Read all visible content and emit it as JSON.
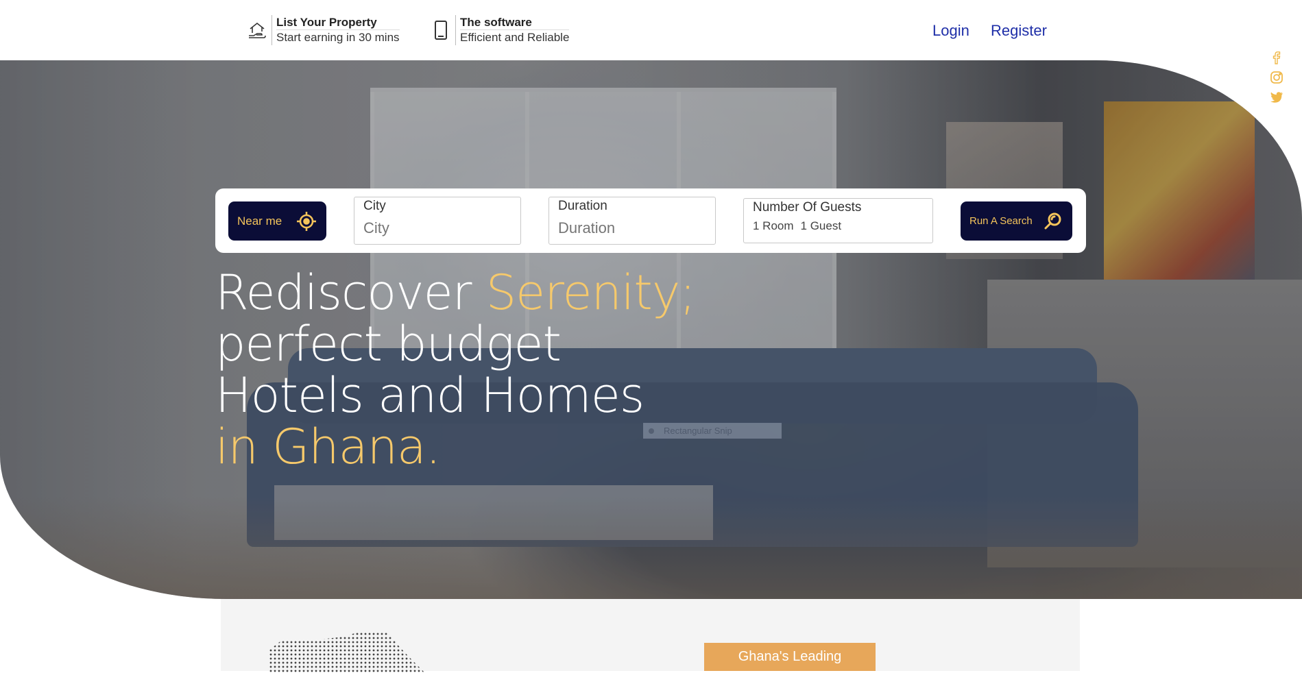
{
  "header": {
    "promo_property": {
      "title": "List Your Property",
      "subtitle": "Start earning in 30 mins",
      "icon": "house-hand-icon"
    },
    "promo_software": {
      "title": "The software",
      "subtitle": "Efficient and Reliable",
      "icon": "smartphone-icon"
    },
    "login_label": "Login",
    "register_label": "Register"
  },
  "search": {
    "near_me_label": "Near me",
    "city_label": "City",
    "city_placeholder": "City",
    "duration_label": "Duration",
    "duration_placeholder": "Duration",
    "guests_label": "Number Of Guests",
    "rooms_value": "1 Room",
    "guests_value": "1 Guest",
    "run_label": "Run A Search"
  },
  "hero": {
    "line1_plain": "Rediscover ",
    "line1_gold": "Serenity;",
    "line2": "perfect budget",
    "line3": "Hotels and Homes",
    "line4_gold": "in Ghana."
  },
  "snip": {
    "label": "Rectangular Snip"
  },
  "social": [
    "facebook-icon",
    "instagram-icon",
    "twitter-icon"
  ],
  "below": {
    "badge_label": "Ghana's Leading"
  },
  "colors": {
    "navy": "#0b0d37",
    "gold": "#f4c45b",
    "accent_orange": "#e7a75a",
    "link_blue": "#1f2fa8"
  }
}
